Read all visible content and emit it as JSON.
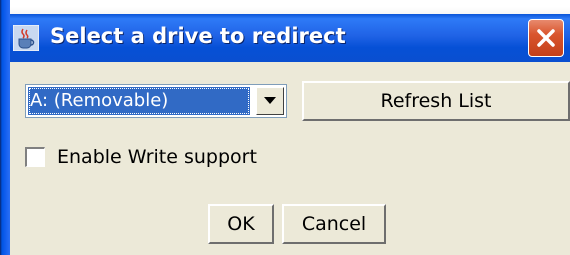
{
  "window": {
    "title": "Select a drive to redirect",
    "icon": "java-cup-icon",
    "close_icon": "close-x-icon"
  },
  "drive_select": {
    "selected": "A: (Removable)",
    "arrow_icon": "chevron-down-icon"
  },
  "buttons": {
    "refresh": "Refresh List",
    "ok": "OK",
    "cancel": "Cancel"
  },
  "write_support": {
    "label": "Enable Write support",
    "checked": false
  },
  "colors": {
    "titlebar": "#0a55d8",
    "selection": "#316ac5",
    "dialog_bg": "#ece9d8",
    "close_button": "#d9552d"
  }
}
